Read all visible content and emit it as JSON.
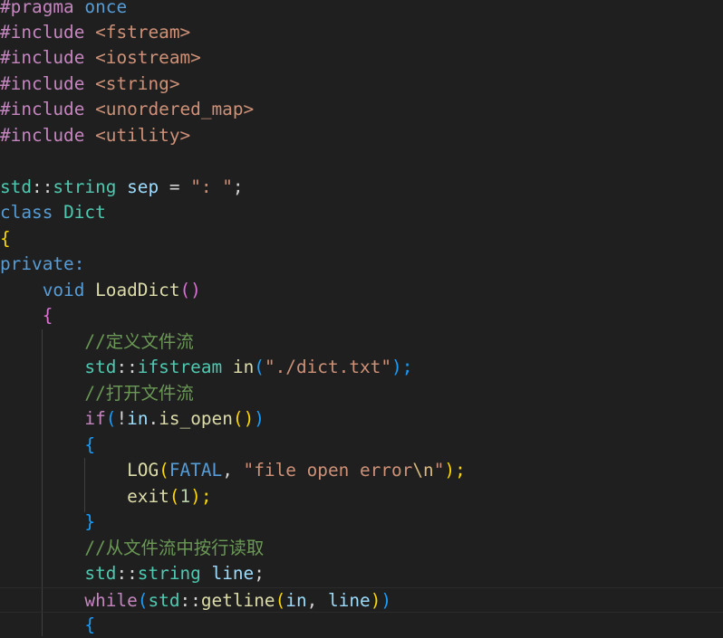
{
  "editor": {
    "language": "cpp",
    "colors": {
      "background": "#1f1f1f",
      "comment": "#6a9955",
      "keyword": "#569cd6",
      "control": "#c586c0",
      "string": "#ce9178",
      "type": "#4ec9b0",
      "function": "#dcdcaa",
      "variable": "#9cdcfe",
      "number": "#b5cea8",
      "bracket_level1": "#ffd700",
      "bracket_level2": "#da70d6",
      "bracket_level3": "#179fff"
    },
    "tokens": {
      "l1": [
        "#pragma",
        " ",
        "once"
      ],
      "l2": [
        "#include",
        " ",
        "<fstream>"
      ],
      "l3": [
        "#include",
        " ",
        "<iostream>"
      ],
      "l4": [
        "#include",
        " ",
        "<string>"
      ],
      "l5": [
        "#include",
        " ",
        "<unordered_map>"
      ],
      "l6": [
        "#include",
        " ",
        "<utility>"
      ],
      "l8": [
        "std",
        "::",
        "string",
        " ",
        "sep",
        " = ",
        "\": \"",
        ";"
      ],
      "l9": [
        "class",
        " ",
        "Dict"
      ],
      "l10": [
        "{"
      ],
      "l11": [
        "private:"
      ],
      "l12": [
        "    ",
        "void",
        " ",
        "LoadDict",
        "()"
      ],
      "l13": [
        "    ",
        "{"
      ],
      "l14": [
        "        ",
        "//定义文件流"
      ],
      "l15": [
        "        ",
        "std",
        "::",
        "ifstream",
        " ",
        "in",
        "(",
        "\"./dict.txt\"",
        ");"
      ],
      "l16": [
        "        ",
        "//打开文件流"
      ],
      "l17": [
        "        ",
        "if",
        "(",
        "!",
        "in",
        ".",
        "is_open",
        "()",
        ")"
      ],
      "l18": [
        "        ",
        "{"
      ],
      "l19": [
        "            ",
        "LOG",
        "(",
        "FATAL",
        ", ",
        "\"file open error",
        "\\n",
        "\"",
        ");"
      ],
      "l20": [
        "            ",
        "exit",
        "(",
        "1",
        ");"
      ],
      "l21": [
        "        ",
        "}"
      ],
      "l22": [
        "        ",
        "//从文件流中按行读取"
      ],
      "l23": [
        "        ",
        "std",
        "::",
        "string",
        " ",
        "line",
        ";"
      ],
      "l24": [
        "        ",
        "while",
        "(",
        "std",
        "::",
        "getline",
        "(",
        "in",
        ", ",
        "line",
        ")",
        ")"
      ],
      "l25": [
        "        ",
        "{"
      ]
    }
  }
}
